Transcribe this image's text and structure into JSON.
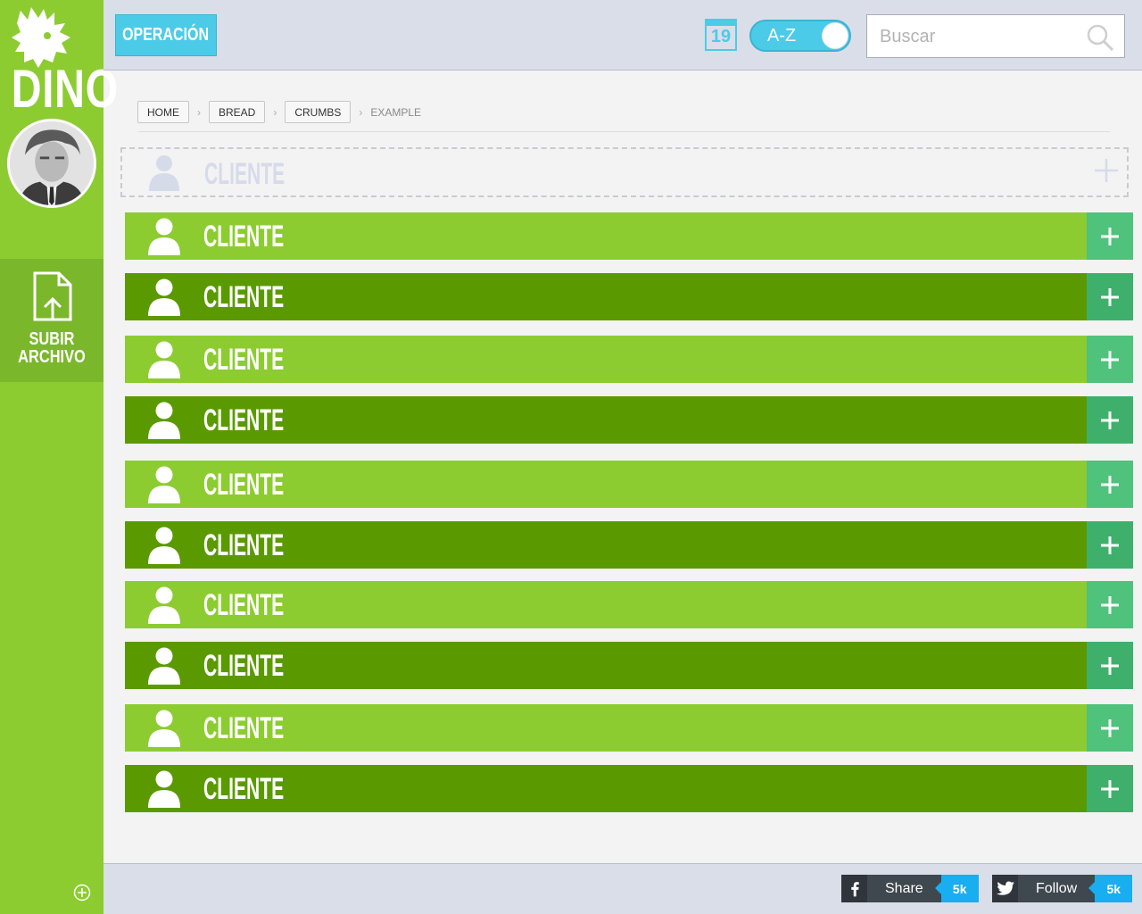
{
  "brand": {
    "logo_text": "DINO"
  },
  "sidebar": {
    "upload_label": "SUBIR ARCHIVO"
  },
  "topbar": {
    "operation_button": "OPERACIÓN",
    "calendar_day": "19",
    "sort_toggle_label": "A-Z",
    "search_placeholder": "Buscar"
  },
  "breadcrumb": {
    "items": [
      "HOME",
      "BREAD",
      "CRUMBS"
    ],
    "current": "EXAMPLE",
    "separator": "›"
  },
  "ghost_row": {
    "label": "CLIENTE"
  },
  "client_rows": [
    {
      "label": "CLIENTE"
    },
    {
      "label": "CLIENTE"
    },
    {
      "label": "CLIENTE"
    },
    {
      "label": "CLIENTE"
    },
    {
      "label": "CLIENTE"
    },
    {
      "label": "CLIENTE"
    },
    {
      "label": "CLIENTE"
    },
    {
      "label": "CLIENTE"
    },
    {
      "label": "CLIENTE"
    },
    {
      "label": "CLIENTE"
    }
  ],
  "footer": {
    "facebook": {
      "label": "Share",
      "count": "5k",
      "icon": "facebook-icon"
    },
    "twitter": {
      "label": "Follow",
      "count": "5k",
      "icon": "twitter-icon"
    }
  },
  "colors": {
    "sidebar_green": "#8ccc31",
    "row_light": "#8ccc31",
    "row_dark": "#5a9a00",
    "plus_light": "#4fc27c",
    "plus_dark": "#3fb06c",
    "accent_cyan": "#4ccbe8",
    "topbar_bg": "#d9dee9",
    "social_count": "#18aef0"
  }
}
